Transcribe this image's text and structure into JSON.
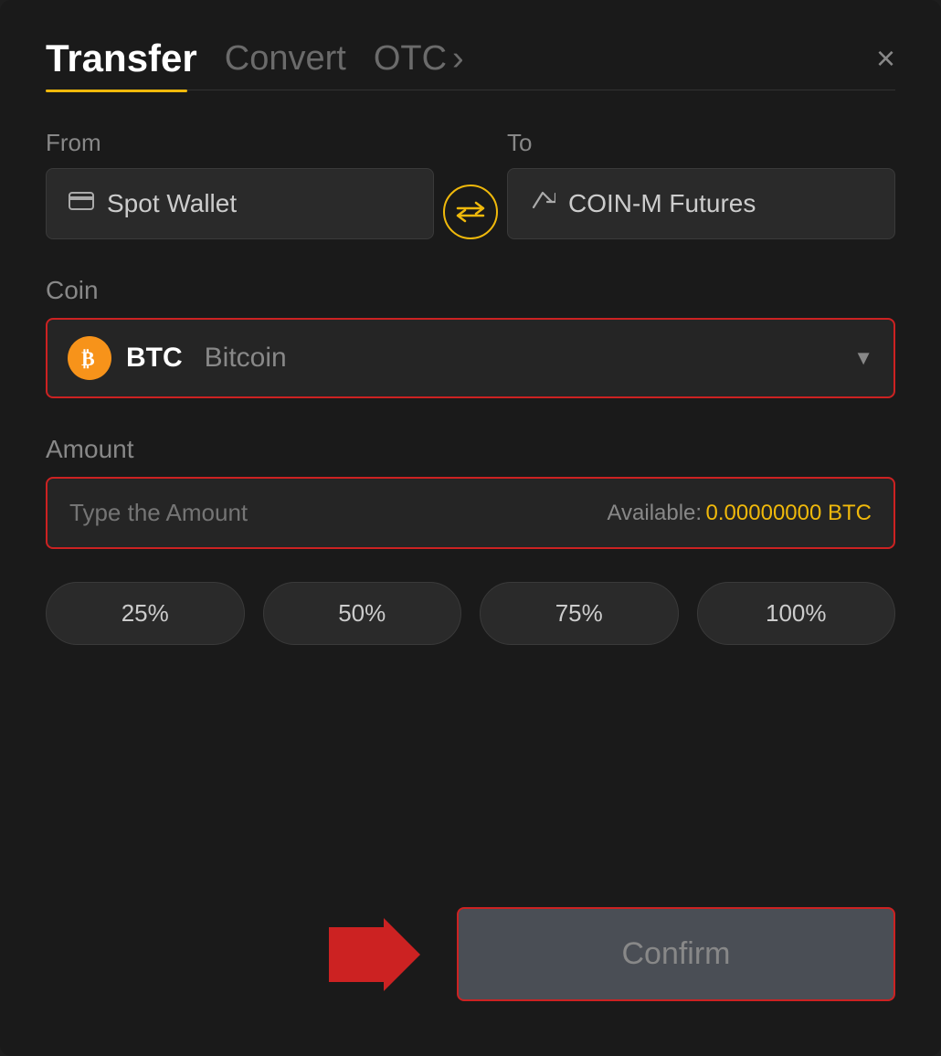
{
  "header": {
    "tab_transfer": "Transfer",
    "tab_convert": "Convert",
    "tab_otc": "OTC",
    "tab_otc_chevron": "›",
    "close_label": "×"
  },
  "from": {
    "label": "From",
    "wallet_icon": "🪪",
    "wallet_name": "Spot Wallet"
  },
  "to": {
    "label": "To",
    "wallet_icon": "↑",
    "wallet_name": "COIN-M Futures"
  },
  "swap": {
    "icon": "⇄"
  },
  "coin": {
    "label": "Coin",
    "symbol": "BTC",
    "name": "Bitcoin",
    "btc_char": "₿"
  },
  "amount": {
    "label": "Amount",
    "placeholder": "Type the Amount",
    "available_label": "Available:",
    "available_value": "0.00000000 BTC"
  },
  "percentages": [
    "25%",
    "50%",
    "75%",
    "100%"
  ],
  "confirm": {
    "label": "Confirm"
  }
}
